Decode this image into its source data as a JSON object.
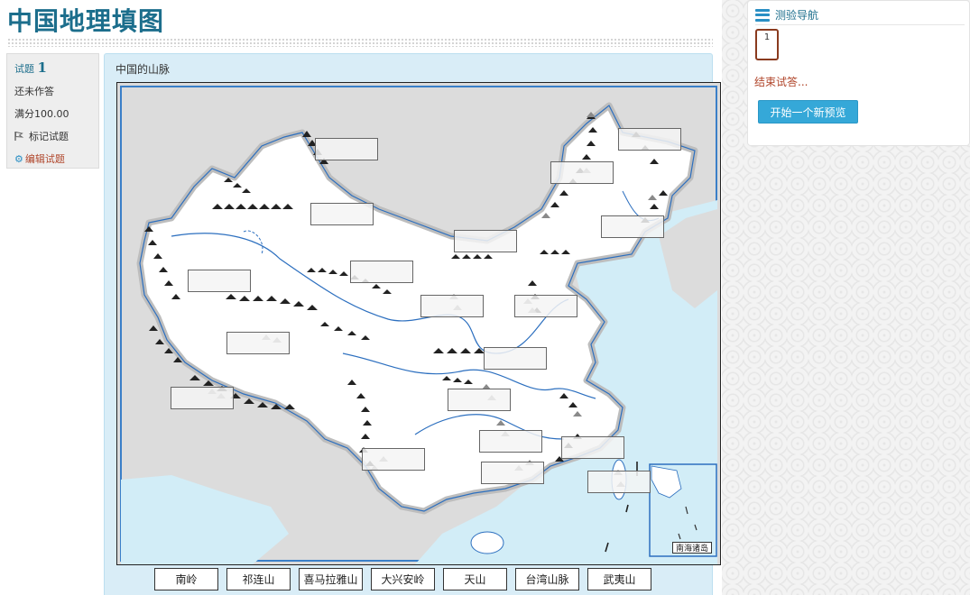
{
  "page": {
    "title": "中国地理填图"
  },
  "question_info": {
    "label": "试题",
    "number": "1",
    "status": "还未作答",
    "max_mark": "满分100.00",
    "flag_label": "标记试题",
    "edit_label": "编辑试题"
  },
  "question": {
    "text": "中国的山脉",
    "inset_label": "南海诸岛",
    "drag_items": [
      "南岭",
      "祁连山",
      "喜马拉雅山",
      "大兴安岭",
      "天山",
      "台湾山脉",
      "武夷山"
    ]
  },
  "nav": {
    "title": "测验导航",
    "question_button": "1",
    "finish_label": "结束试答...",
    "new_preview_label": "开始一个新预览"
  },
  "colors": {
    "accent": "#1c6e8c",
    "panel": "#d9edf7",
    "button": "#35a8d8",
    "link_red": "#b0452a",
    "sea": "#d2edf7",
    "land_outside": "#dcdcdc"
  }
}
